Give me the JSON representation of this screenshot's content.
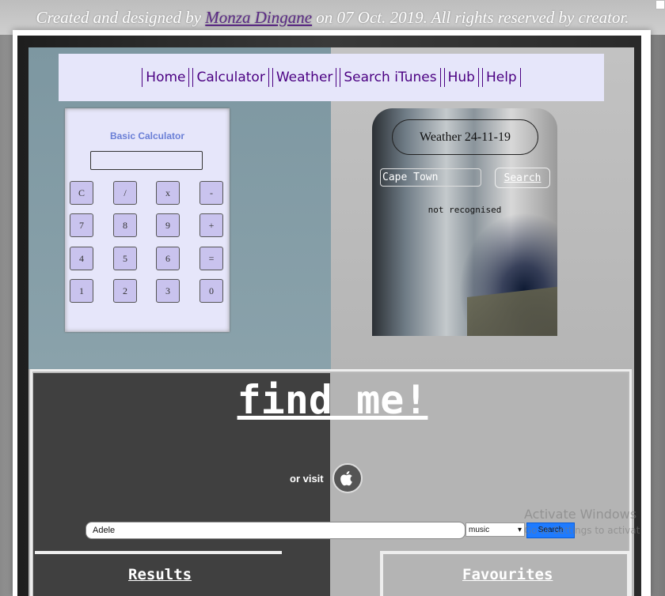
{
  "credit": {
    "prefix": "Created and designed by ",
    "author": "Monza Dingane",
    "suffix": " on 07 Oct. 2019. All rights reserved by creator."
  },
  "nav": {
    "items": [
      "Home",
      "Calculator",
      "Weather",
      "Search iTunes",
      "Hub",
      "Help"
    ]
  },
  "calculator": {
    "title": "Basic Calculator",
    "display": "",
    "keys": [
      "C",
      "/",
      "x",
      "-",
      "7",
      "8",
      "9",
      "+",
      "4",
      "5",
      "6",
      "=",
      "1",
      "2",
      "3",
      "0"
    ]
  },
  "weather": {
    "title": "Weather 24-11-19",
    "city": "Cape Town",
    "search_label": "Search",
    "status": "not recognised"
  },
  "itunes": {
    "heading": "find me!",
    "or_visit": "or visit",
    "apple_icon": "apple-icon",
    "query": "Adele",
    "media": "music",
    "search_label": "Search"
  },
  "panels": {
    "results_title": "Results",
    "favourites_title": "Favourites"
  },
  "watermark": {
    "line1": "Activate Windows",
    "line2": "Go to Settings to activat"
  },
  "colors": {
    "nav_bg": "#e6e6fa",
    "nav_text": "#4b0082",
    "calc_key": "#c9c3ee",
    "itunes_search_btn": "#1e7bff"
  }
}
